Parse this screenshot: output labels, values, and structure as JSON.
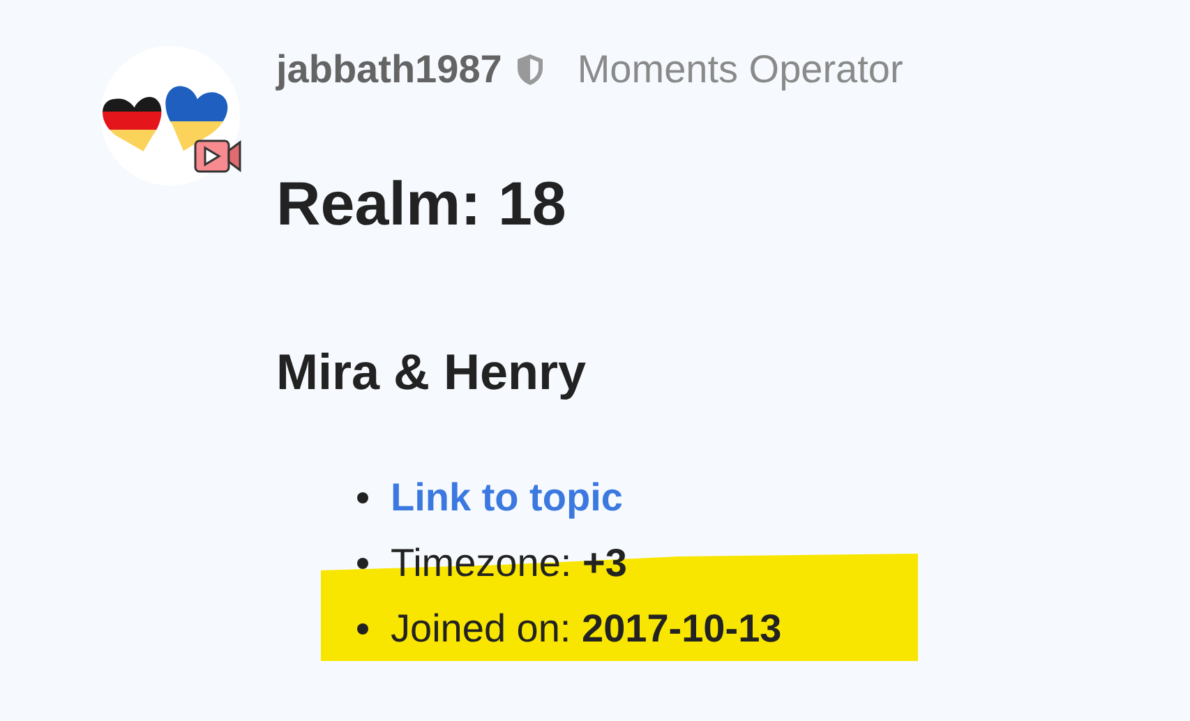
{
  "user": {
    "name": "jabbath1987",
    "title": "Moments Operator"
  },
  "heading": "Realm: 18",
  "subheading": "Mira & Henry",
  "items": [
    {
      "kind": "link",
      "text": "**Link to topic**",
      "highlighted": false
    },
    {
      "kind": "field",
      "text": "Timezone: **+3**",
      "highlighted": false
    },
    {
      "kind": "field",
      "text": "Joined on: **2017-10-13**",
      "highlighted": true
    }
  ]
}
